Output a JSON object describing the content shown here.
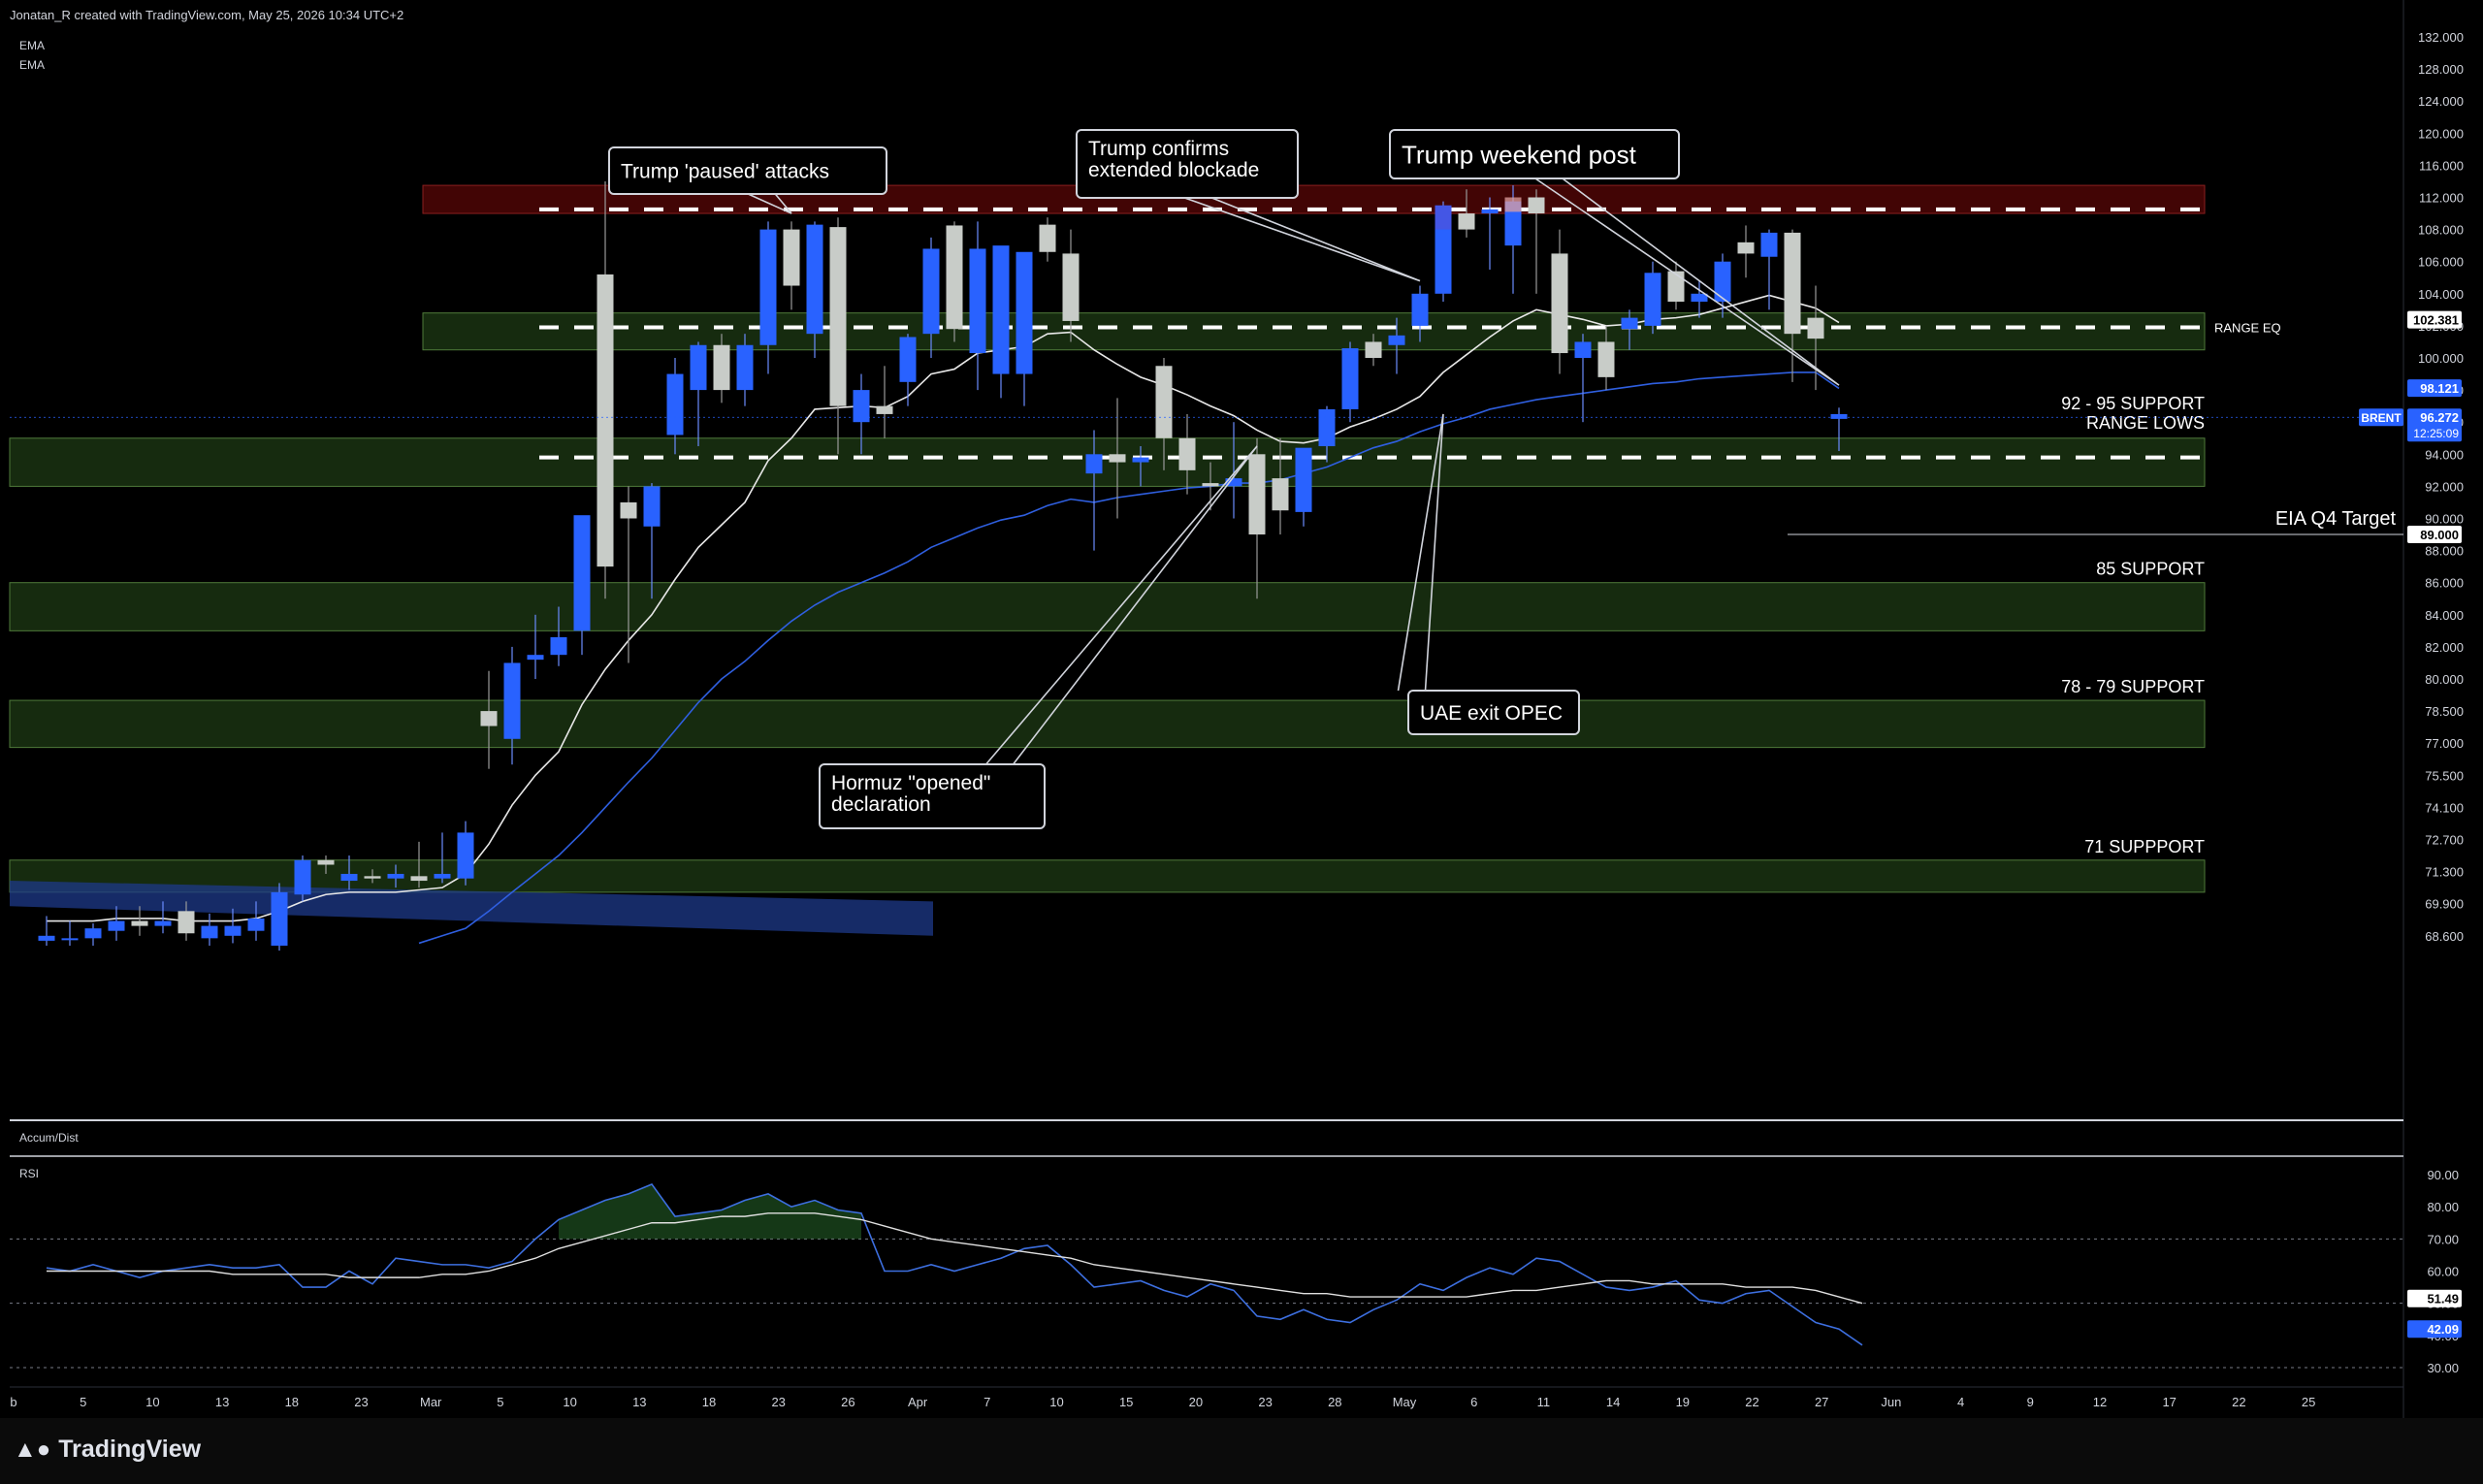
{
  "header": {
    "credit": "Jonatan_R created with TradingView.com, May 25, 2026 10:34 UTC+2"
  },
  "indicators": {
    "ema1": "EMA",
    "ema2": "EMA",
    "accum": "Accum/Dist",
    "rsi": "RSI"
  },
  "brand": {
    "logo_icon": "tradingview-logo-icon",
    "name": "TradingView"
  },
  "colors": {
    "bull": "#2962ff",
    "bear": "#c8ccc8",
    "supportZone": "#1e3a14",
    "resistZone": "#4d0606",
    "ema_fast": "#e8e8e8",
    "ema_slow": "#2f5fe0",
    "rsi": "#3d6fe0"
  },
  "chart_data": {
    "type": "candlestick",
    "symbol": "BRENT",
    "last_price": "96.272",
    "countdown": "12:25:09",
    "price_axis": {
      "ticks": [
        "132.000",
        "128.000",
        "124.000",
        "120.000",
        "116.000",
        "112.000",
        "108.000",
        "106.000",
        "104.000",
        "102.000",
        "100.000",
        "98.000",
        "96.000",
        "94.000",
        "92.000",
        "90.000",
        "88.000",
        "86.000",
        "84.000",
        "82.000",
        "80.000",
        "78.500",
        "77.000",
        "75.500",
        "74.100",
        "72.700",
        "71.300",
        "69.900",
        "68.600"
      ]
    },
    "price_labels": [
      {
        "price": 102.381,
        "text": "102.381",
        "style": "white"
      },
      {
        "price": 98.121,
        "text": "98.121",
        "style": "blue"
      },
      {
        "price": 89.0,
        "text": "89.000",
        "style": "white"
      }
    ],
    "time_axis": [
      "b",
      "5",
      "10",
      "13",
      "18",
      "23",
      "Mar",
      "5",
      "10",
      "13",
      "18",
      "23",
      "26",
      "Apr",
      "7",
      "10",
      "15",
      "20",
      "23",
      "28",
      "May",
      "6",
      "11",
      "14",
      "19",
      "22",
      "27",
      "Jun",
      "4",
      "9",
      "12",
      "17",
      "22",
      "25"
    ],
    "candles": [
      {
        "o": 68.4,
        "h": 69.4,
        "l": 68.2,
        "c": 68.6
      },
      {
        "o": 68.5,
        "h": 69.2,
        "l": 68.2,
        "c": 68.5
      },
      {
        "o": 68.5,
        "h": 69.1,
        "l": 68.2,
        "c": 68.9
      },
      {
        "o": 68.8,
        "h": 69.8,
        "l": 68.4,
        "c": 69.2
      },
      {
        "o": 69.2,
        "h": 69.8,
        "l": 68.6,
        "c": 69.0
      },
      {
        "o": 69.0,
        "h": 70.0,
        "l": 68.7,
        "c": 69.2
      },
      {
        "o": 69.6,
        "h": 70.0,
        "l": 68.4,
        "c": 68.7
      },
      {
        "o": 68.5,
        "h": 69.5,
        "l": 68.2,
        "c": 69.0
      },
      {
        "o": 68.6,
        "h": 69.7,
        "l": 68.3,
        "c": 69.0
      },
      {
        "o": 68.8,
        "h": 70.0,
        "l": 68.4,
        "c": 69.3
      },
      {
        "o": 68.2,
        "h": 70.8,
        "l": 68.0,
        "c": 70.4
      },
      {
        "o": 70.3,
        "h": 72.0,
        "l": 70.0,
        "c": 71.8
      },
      {
        "o": 71.8,
        "h": 72.0,
        "l": 71.2,
        "c": 71.6
      },
      {
        "o": 70.9,
        "h": 72.0,
        "l": 70.5,
        "c": 71.2
      },
      {
        "o": 71.1,
        "h": 71.4,
        "l": 70.8,
        "c": 71.0
      },
      {
        "o": 71.0,
        "h": 71.6,
        "l": 70.6,
        "c": 71.2
      },
      {
        "o": 71.1,
        "h": 72.6,
        "l": 70.6,
        "c": 70.9
      },
      {
        "o": 71.0,
        "h": 73.0,
        "l": 70.8,
        "c": 71.2
      },
      {
        "o": 71.0,
        "h": 73.5,
        "l": 70.7,
        "c": 73.0
      },
      {
        "o": 78.5,
        "h": 80.5,
        "l": 75.8,
        "c": 77.8
      },
      {
        "o": 77.2,
        "h": 82.0,
        "l": 76.0,
        "c": 81.0
      },
      {
        "o": 81.2,
        "h": 84.0,
        "l": 80.0,
        "c": 81.5
      },
      {
        "o": 81.5,
        "h": 84.5,
        "l": 80.8,
        "c": 82.6
      },
      {
        "o": 83.0,
        "h": 86.0,
        "l": 81.5,
        "c": 90.2
      },
      {
        "o": 105.2,
        "h": 114.0,
        "l": 85.0,
        "c": 87.0
      },
      {
        "o": 91.0,
        "h": 92.0,
        "l": 81.0,
        "c": 90.0
      },
      {
        "o": 89.5,
        "h": 92.2,
        "l": 85.0,
        "c": 92.0
      },
      {
        "o": 95.2,
        "h": 100.0,
        "l": 94.0,
        "c": 99.0
      },
      {
        "o": 98.0,
        "h": 101.0,
        "l": 94.5,
        "c": 100.8
      },
      {
        "o": 100.8,
        "h": 101.5,
        "l": 97.2,
        "c": 98.0
      },
      {
        "o": 98.0,
        "h": 101.5,
        "l": 97.0,
        "c": 100.8
      },
      {
        "o": 100.8,
        "h": 109.0,
        "l": 99.0,
        "c": 108.0
      },
      {
        "o": 108.0,
        "h": 109.0,
        "l": 103.0,
        "c": 104.5
      },
      {
        "o": 101.5,
        "h": 109.0,
        "l": 100.0,
        "c": 108.6
      },
      {
        "o": 108.3,
        "h": 109.5,
        "l": 94.0,
        "c": 97.0
      },
      {
        "o": 96.0,
        "h": 99.0,
        "l": 94.0,
        "c": 98.0
      },
      {
        "o": 97.0,
        "h": 99.5,
        "l": 95.0,
        "c": 96.5
      },
      {
        "o": 98.5,
        "h": 101.5,
        "l": 97.0,
        "c": 101.3
      },
      {
        "o": 101.5,
        "h": 107.5,
        "l": 100.0,
        "c": 106.8
      },
      {
        "o": 108.5,
        "h": 109.0,
        "l": 101.0,
        "c": 101.8
      },
      {
        "o": 100.3,
        "h": 109.0,
        "l": 98.0,
        "c": 106.8
      },
      {
        "o": 99.0,
        "h": 106.0,
        "l": 97.5,
        "c": 107.0
      },
      {
        "o": 99.0,
        "h": 106.0,
        "l": 97.0,
        "c": 106.6
      },
      {
        "o": 108.6,
        "h": 109.5,
        "l": 106.0,
        "c": 106.6
      },
      {
        "o": 106.5,
        "h": 108.0,
        "l": 101.0,
        "c": 102.3
      },
      {
        "o": 92.8,
        "h": 95.5,
        "l": 88.0,
        "c": 94.0
      },
      {
        "o": 94.0,
        "h": 97.5,
        "l": 90.0,
        "c": 93.5
      },
      {
        "o": 93.5,
        "h": 94.5,
        "l": 92.0,
        "c": 93.8
      },
      {
        "o": 99.5,
        "h": 100.0,
        "l": 93.0,
        "c": 95.0
      },
      {
        "o": 95.0,
        "h": 96.5,
        "l": 91.5,
        "c": 93.0
      },
      {
        "o": 92.2,
        "h": 93.5,
        "l": 90.5,
        "c": 92.0
      },
      {
        "o": 92.0,
        "h": 96.0,
        "l": 90.0,
        "c": 92.5
      },
      {
        "o": 94.0,
        "h": 95.0,
        "l": 85.0,
        "c": 89.0
      },
      {
        "o": 92.5,
        "h": 95.0,
        "l": 89.0,
        "c": 90.5
      },
      {
        "o": 90.4,
        "h": 94.0,
        "l": 89.5,
        "c": 94.4
      },
      {
        "o": 94.5,
        "h": 97.0,
        "l": 93.5,
        "c": 96.8
      },
      {
        "o": 96.8,
        "h": 101.0,
        "l": 96.0,
        "c": 100.6
      },
      {
        "o": 101.0,
        "h": 101.5,
        "l": 99.5,
        "c": 100.0
      },
      {
        "o": 100.8,
        "h": 102.5,
        "l": 99.0,
        "c": 101.4
      },
      {
        "o": 102.0,
        "h": 104.5,
        "l": 101.0,
        "c": 104.0
      },
      {
        "o": 104.0,
        "h": 111.5,
        "l": 103.5,
        "c": 111.0
      },
      {
        "o": 110.0,
        "h": 113.0,
        "l": 107.5,
        "c": 108.0
      },
      {
        "o": 110.0,
        "h": 112.0,
        "l": 105.5,
        "c": 110.5
      },
      {
        "o": 107.0,
        "h": 113.5,
        "l": 104.0,
        "c": 111.5
      },
      {
        "o": 112.0,
        "h": 113.0,
        "l": 104.0,
        "c": 110.0
      },
      {
        "o": 106.5,
        "h": 108.0,
        "l": 99.0,
        "c": 100.3
      },
      {
        "o": 100.0,
        "h": 101.5,
        "l": 96.0,
        "c": 101.0
      },
      {
        "o": 101.0,
        "h": 102.0,
        "l": 98.0,
        "c": 98.8
      },
      {
        "o": 101.8,
        "h": 103.0,
        "l": 100.5,
        "c": 102.5
      },
      {
        "o": 102.0,
        "h": 106.0,
        "l": 101.5,
        "c": 105.3
      },
      {
        "o": 105.4,
        "h": 106.0,
        "l": 103.0,
        "c": 103.5
      },
      {
        "o": 103.5,
        "h": 104.8,
        "l": 102.5,
        "c": 104.0
      },
      {
        "o": 103.5,
        "h": 106.5,
        "l": 102.5,
        "c": 106.0
      },
      {
        "o": 107.2,
        "h": 108.5,
        "l": 105.0,
        "c": 106.5
      },
      {
        "o": 106.3,
        "h": 108.0,
        "l": 103.0,
        "c": 107.8
      },
      {
        "o": 107.8,
        "h": 108.0,
        "l": 98.5,
        "c": 101.5
      },
      {
        "o": 102.5,
        "h": 104.5,
        "l": 98.0,
        "c": 101.2
      },
      {
        "o": 96.2,
        "h": 96.9,
        "l": 94.2,
        "c": 96.5
      }
    ],
    "ema_fast": [
      69.2,
      69.2,
      69.2,
      69.3,
      69.3,
      69.3,
      69.2,
      69.2,
      69.2,
      69.3,
      69.6,
      70.0,
      70.3,
      70.4,
      70.4,
      70.4,
      70.5,
      70.6,
      71.2,
      72.5,
      74.2,
      75.5,
      76.6,
      78.8,
      80.6,
      82.4,
      84.0,
      86.2,
      88.2,
      89.6,
      91.0,
      93.6,
      95.0,
      96.8,
      96.9,
      97.0,
      96.9,
      97.6,
      99.0,
      99.3,
      100.3,
      100.5,
      100.7,
      101.5,
      101.6,
      100.5,
      99.6,
      98.8,
      98.3,
      97.7,
      97.0,
      96.4,
      95.5,
      94.8,
      94.7,
      95.0,
      95.7,
      96.2,
      96.8,
      97.6,
      99.1,
      100.2,
      101.3,
      102.3,
      103.0,
      102.7,
      102.4,
      102.0,
      102.1,
      102.4,
      102.5,
      102.7,
      103.1,
      103.5,
      103.9,
      103.5,
      103.1,
      102.2
    ],
    "ema_slow": [
      null,
      null,
      null,
      null,
      null,
      null,
      null,
      null,
      null,
      null,
      null,
      null,
      null,
      null,
      null,
      null,
      68.3,
      68.6,
      68.9,
      69.6,
      70.4,
      71.2,
      72.0,
      73.0,
      74.1,
      75.2,
      76.3,
      77.6,
      78.9,
      80.0,
      81.1,
      82.4,
      83.6,
      84.6,
      85.4,
      86.0,
      86.6,
      87.3,
      88.2,
      88.8,
      89.4,
      89.9,
      90.2,
      90.8,
      91.2,
      91.0,
      91.3,
      91.5,
      91.7,
      91.9,
      92.0,
      92.2,
      92.2,
      92.4,
      92.8,
      93.2,
      93.8,
      94.4,
      94.8,
      95.4,
      95.9,
      96.3,
      96.8,
      97.1,
      97.4,
      97.6,
      97.8,
      98.0,
      98.2,
      98.4,
      98.5,
      98.7,
      98.8,
      98.9,
      99.0,
      99.1,
      99.1,
      98.1
    ],
    "zones": [
      {
        "top": 113.5,
        "bottom": 110.0,
        "kind": "resistance",
        "label": ""
      },
      {
        "top": 102.8,
        "bottom": 100.5,
        "kind": "support",
        "label": "RANGE EQ"
      },
      {
        "top": 95.0,
        "bottom": 92.0,
        "kind": "support",
        "label": "92 - 95 SUPPORT",
        "label2": "RANGE LOWS"
      },
      {
        "top": 86.0,
        "bottom": 83.0,
        "kind": "support",
        "label": "85 SUPPORT"
      },
      {
        "top": 79.0,
        "bottom": 76.8,
        "kind": "support",
        "label": "78 - 79 SUPPORT"
      },
      {
        "top": 71.8,
        "bottom": 70.4,
        "kind": "support",
        "label": "71 SUPPPORT"
      }
    ],
    "dashed_levels": [
      110.5,
      101.9,
      93.8
    ],
    "eia_target": {
      "price": 89.0,
      "label": "EIA Q4 Target"
    },
    "annotations": [
      {
        "text": [
          "Trump 'paused' attacks"
        ],
        "candle": 32,
        "price": 110.0
      },
      {
        "text": [
          "Trump confirms",
          "extended blockade"
        ],
        "candle": 59,
        "price": 104.8
      },
      {
        "text": [
          "Trump weekend post"
        ],
        "candle": 77,
        "price": 98.3
      },
      {
        "text": [
          "UAE exit OPEC"
        ],
        "candle": 60,
        "price": 96.5
      },
      {
        "text": [
          "Hormuz \"opened\"",
          "declaration"
        ],
        "candle": 52,
        "price": 94.5
      }
    ],
    "rsi": {
      "ticks": [
        "90.00",
        "80.00",
        "70.00",
        "60.00",
        "50.00",
        "40.00",
        "30.00"
      ],
      "levels": [
        70,
        50,
        30
      ],
      "last": "51.49",
      "ma_last": "42.09",
      "values": [
        61,
        60,
        62,
        60,
        58,
        60,
        61,
        62,
        61,
        61,
        62,
        55,
        55,
        60,
        56,
        64,
        63,
        62,
        62,
        61,
        63,
        70,
        76,
        79,
        82,
        84,
        87,
        77,
        78,
        79,
        82,
        84,
        80,
        82,
        79,
        78,
        60,
        60,
        62,
        60,
        62,
        64,
        67,
        68,
        62,
        55,
        56,
        57,
        54,
        52,
        56,
        54,
        46,
        45,
        48,
        45,
        44,
        48,
        51,
        56,
        54,
        58,
        61,
        59,
        64,
        63,
        59,
        55,
        54,
        55,
        57,
        51,
        50,
        53,
        54,
        49,
        44,
        42,
        37
      ],
      "ma": [
        60,
        60,
        60,
        60,
        60,
        60,
        60,
        60,
        59,
        59,
        59,
        59,
        59,
        58,
        58,
        58,
        58,
        59,
        59,
        60,
        62,
        64,
        67,
        69,
        71,
        73,
        75,
        75,
        76,
        77,
        77,
        78,
        78,
        78,
        77,
        76,
        74,
        72,
        70,
        69,
        68,
        67,
        66,
        65,
        64,
        62,
        61,
        60,
        59,
        58,
        57,
        56,
        55,
        54,
        53,
        53,
        52,
        52,
        52,
        52,
        52,
        52,
        53,
        54,
        54,
        55,
        56,
        57,
        57,
        56,
        56,
        56,
        56,
        55,
        55,
        55,
        54,
        52,
        50
      ]
    }
  }
}
